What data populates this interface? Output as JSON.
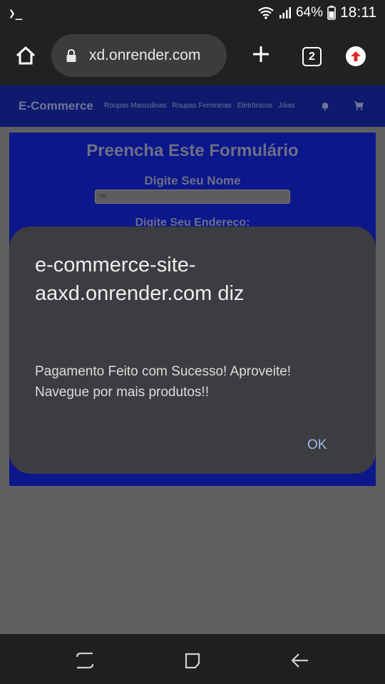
{
  "status_bar": {
    "terminal_glyph": "❯_",
    "battery_percent": "64%",
    "time": "18:11"
  },
  "browser": {
    "url": "xd.onrender.com",
    "tab_count": "2"
  },
  "site": {
    "brand": "E-Commerce",
    "nav_links": [
      "Roupas Masculinas",
      "Roupas Femininas",
      "Eletrônicos",
      "Jóias"
    ],
    "form_title": "Preencha Este Formulário",
    "name_label": "Digite Seu Nome",
    "name_value": "Nel",
    "address_label": "Digite Seu Endereço:"
  },
  "dialog": {
    "title": "e-commerce-site-aaxd.onrender.com diz",
    "message": "Pagamento Feito com Sucesso! Aproveite! Navegue por mais produtos!!",
    "ok_label": "OK"
  },
  "colors": {
    "navbar_bg": "#0d1a6d",
    "form_bg": "#0c178b",
    "dialog_bg": "#3c3d40",
    "ok_text": "#9fb7e8"
  }
}
